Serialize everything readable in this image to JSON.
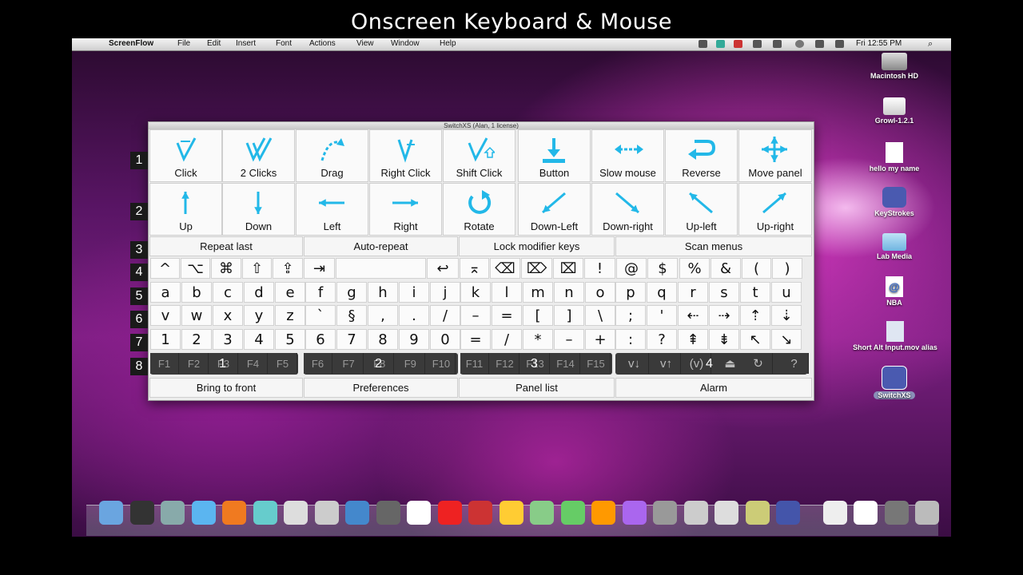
{
  "banner": {
    "title": "Onscreen Keyboard & Mouse"
  },
  "menubar": {
    "app": "ScreenFlow",
    "items": [
      "File",
      "Edit",
      "Insert",
      "Font",
      "Actions",
      "View",
      "Window",
      "Help"
    ],
    "clock": "Fri 12:55 PM"
  },
  "desktop": {
    "icons": [
      "Macintosh HD",
      "Growl-1.2.1",
      "hello my name",
      "KeyStrokes",
      "Lab Media",
      "NBA",
      "Short Alt Input.mov alias",
      "SwitchXS"
    ]
  },
  "panel": {
    "title": "SwitchXS (Alan, 1 license)",
    "row_numbers": [
      "1",
      "2",
      "3",
      "4",
      "5",
      "6",
      "7",
      "8"
    ],
    "mouse_row1": [
      "Click",
      "2 Clicks",
      "Drag",
      "Right Click",
      "Shift Click",
      "Button",
      "Slow mouse",
      "Reverse",
      "Move panel"
    ],
    "mouse_row2": [
      "Up",
      "Down",
      "Left",
      "Right",
      "Rotate",
      "Down-Left",
      "Down-right",
      "Up-left",
      "Up-right"
    ],
    "bar_top": [
      "Repeat last",
      "Auto-repeat",
      "Lock modifier keys",
      "Scan menus"
    ],
    "row4": [
      "^",
      "⌥",
      "⌘",
      "⇧",
      "⇪",
      "⇥",
      "",
      "↩",
      "⌅",
      "⌫",
      "⌦",
      "⌧",
      "!",
      "@",
      "$",
      "%",
      "&",
      "(",
      ")"
    ],
    "row5": [
      "a",
      "b",
      "c",
      "d",
      "e",
      "f",
      "g",
      "h",
      "i",
      "j",
      "k",
      "l",
      "m",
      "n",
      "o",
      "p",
      "q",
      "r",
      "s",
      "t",
      "u"
    ],
    "row6": [
      "v",
      "w",
      "x",
      "y",
      "z",
      "`",
      "§",
      ",",
      ".",
      "/",
      "–",
      "=",
      "[",
      "]",
      "\\",
      ";",
      "'",
      "⇠",
      "⇢",
      "⇡",
      "⇣"
    ],
    "row7": [
      "1",
      "2",
      "3",
      "4",
      "5",
      "6",
      "7",
      "8",
      "9",
      "0",
      "=",
      "/",
      "*",
      "–",
      "+",
      ":",
      "?",
      "⇞",
      "⇟",
      "↖",
      "↘"
    ],
    "fkeys": [
      "F1",
      "F2",
      "F3",
      "F4",
      "F5",
      "F6",
      "F7",
      "F8",
      "F9",
      "F10",
      "F11",
      "F12",
      "F13",
      "F14",
      "F15"
    ],
    "fgroup_numbers": [
      "1",
      "2",
      "3",
      "4"
    ],
    "fextra": [
      "v↓",
      "v↑",
      "(v)",
      "⏏",
      "↻",
      "?"
    ],
    "bar_bottom": [
      "Bring to front",
      "Preferences",
      "Panel list",
      "Alarm"
    ]
  },
  "colors": {
    "accent": "#22b8e8"
  }
}
